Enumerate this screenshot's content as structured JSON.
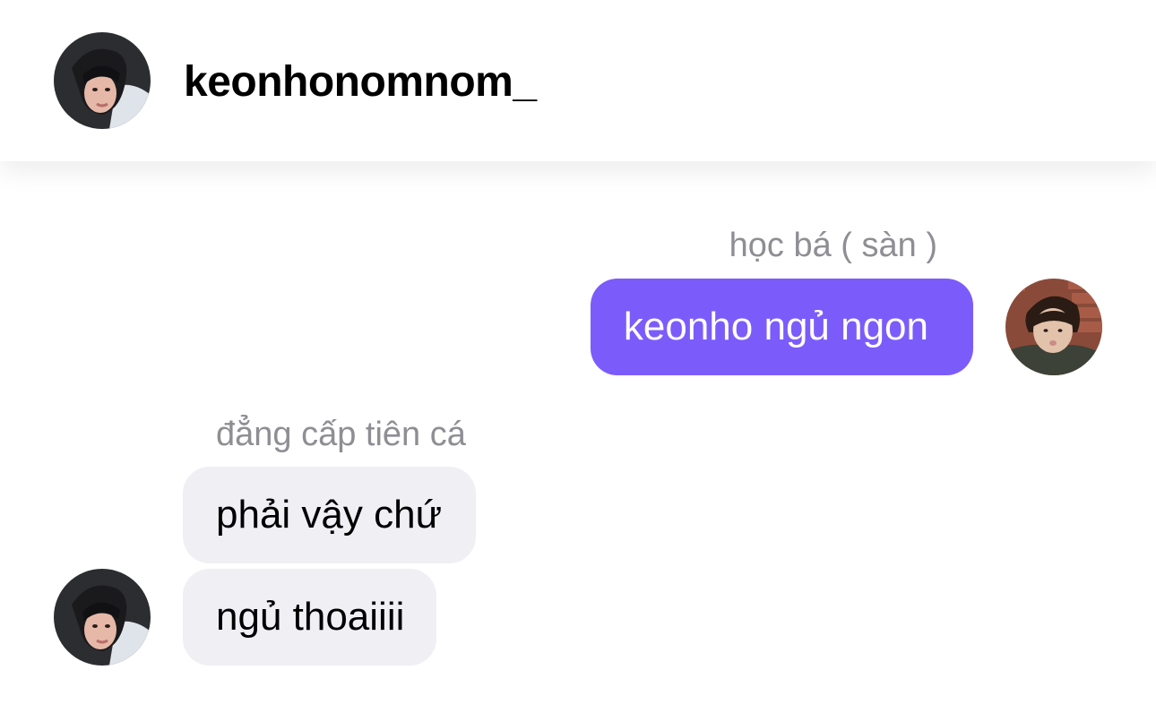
{
  "header": {
    "username": "keonhonomnom_",
    "avatar_icon": "contact-avatar-photo"
  },
  "messages": [
    {
      "sender_label": "học bá ( sàn )",
      "text": "keonho ngủ ngon",
      "direction": "outgoing",
      "bubble_color": "#7b5cfa",
      "avatar_icon": "my-avatar-photo"
    },
    {
      "sender_label": "đẳng cấp tiên cá",
      "direction": "incoming",
      "bubble_color": "#efeff4",
      "texts": [
        "phải vậy chứ",
        "ngủ thoaiiii"
      ],
      "avatar_icon": "contact-avatar-photo"
    }
  ],
  "colors": {
    "outgoing_bubble": "#7b5cfa",
    "incoming_bubble": "#efeff4",
    "label_gray": "#8e8e93"
  }
}
